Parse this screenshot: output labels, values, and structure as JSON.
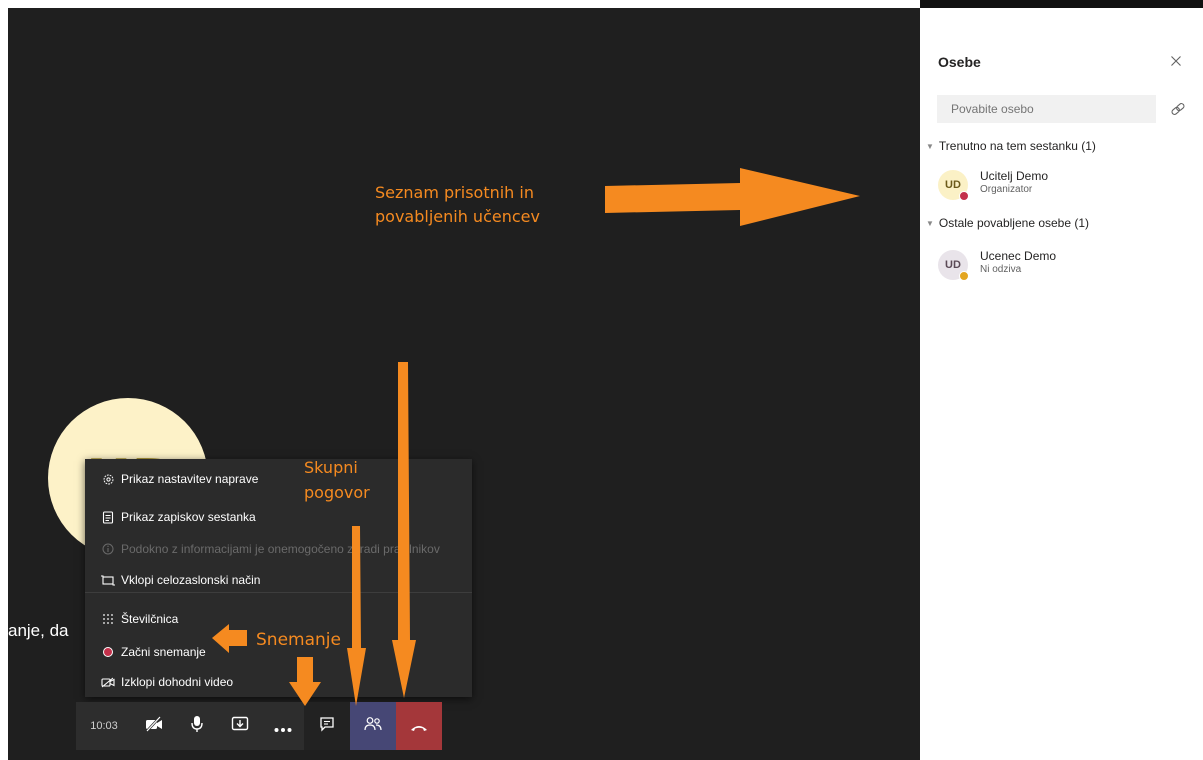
{
  "caption": "anje, da",
  "avatar_initials": "UD",
  "more_menu": {
    "items": [
      {
        "label": "Prikaz nastavitev naprave",
        "icon": "gear-icon"
      },
      {
        "label": "Prikaz zapiskov sestanka",
        "icon": "notes-icon"
      },
      {
        "label": "Podokno z informacijami je onemogočeno zaradi pravilnikov",
        "icon": "info-icon",
        "disabled": true
      },
      {
        "label": "Vklopi celozaslonski način",
        "icon": "fullscreen-icon"
      },
      {
        "label": "Številčnica",
        "icon": "dialpad-icon"
      },
      {
        "label": "Začni snemanje",
        "icon": "record-icon"
      },
      {
        "label": "Izklopi dohodni video",
        "icon": "video-off-icon"
      }
    ]
  },
  "toolbar": {
    "time": "10:03",
    "buttons": [
      "camera-off-icon",
      "microphone-icon",
      "share-tray-icon",
      "more-icon",
      "chat-icon",
      "people-icon",
      "hangup-icon"
    ]
  },
  "annotations": {
    "roster": "Seznam prisotnih in\npovabljenih učencev",
    "chat": "Skupni\npogovor",
    "recording": "Snemanje"
  },
  "people_panel": {
    "title": "Osebe",
    "invite_placeholder": "Povabite osebo",
    "sections": [
      {
        "title": "Trenutno na tem sestanku (1)",
        "people": [
          {
            "initials": "UD",
            "name": "Ucitelj Demo",
            "role": "Organizator",
            "status_color": "#c4314b",
            "avatar_color": "#fbf1c6"
          }
        ]
      },
      {
        "title": "Ostale povabljene osebe (1)",
        "people": [
          {
            "initials": "UD",
            "name": "Ucenec Demo",
            "role": "Ni odziva",
            "status_color": "#e3a521",
            "avatar_color": "#e9e4ea"
          }
        ]
      }
    ]
  },
  "colors": {
    "stage_bg": "#1f1f1f",
    "annotation": "#f58a20",
    "people_active": "#464775",
    "hangup": "#a4373a"
  }
}
